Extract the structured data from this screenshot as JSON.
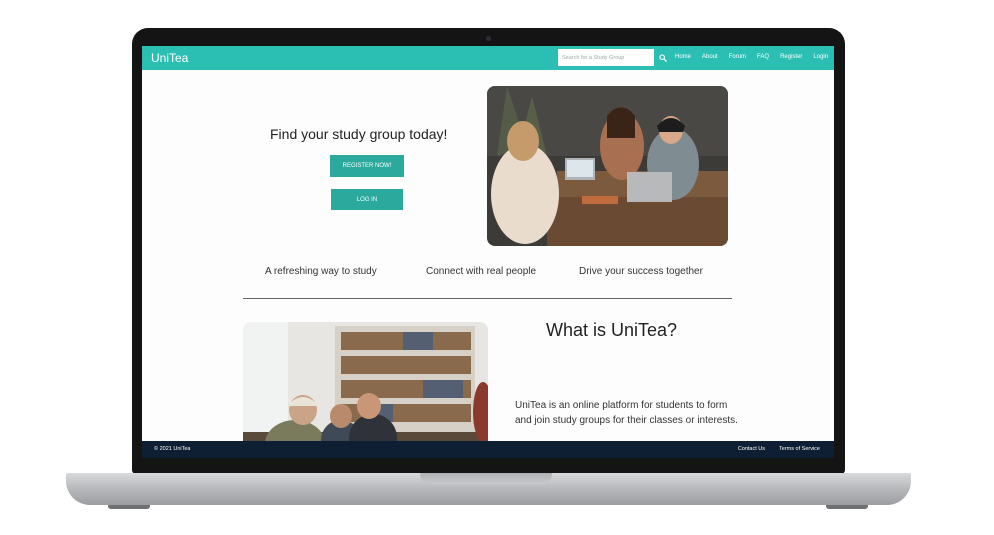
{
  "app": {
    "brand": "UniTea",
    "colors": {
      "accent": "#2bbfb3",
      "button": "#2ba99d",
      "footer": "#0f1f33"
    }
  },
  "nav": {
    "search_placeholder": "Search for a Study Group",
    "search_icon": "search-icon",
    "links": [
      "Home",
      "About",
      "Forum",
      "FAQ",
      "Register",
      "Login"
    ]
  },
  "hero": {
    "title": "Find your study group today!",
    "register_label": "REGISTER NOW!",
    "login_label": "LOG IN"
  },
  "features": [
    "A refreshing way to study",
    "Connect with real people",
    "Drive your success together"
  ],
  "about": {
    "title": "What is UniTea?",
    "description": "UniTea is an online platform for students to form and join study groups for their classes or interests."
  },
  "footer": {
    "copyright": "© 2021 UniTea",
    "links": [
      "Contact Us",
      "Terms of Service"
    ]
  }
}
